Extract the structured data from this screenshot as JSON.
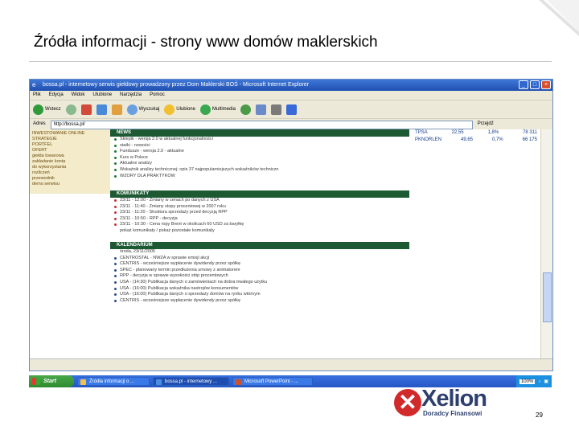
{
  "slide": {
    "title": "Źródła informacji - strony www domów maklerskich",
    "page_number": "29"
  },
  "browser": {
    "window_title": "bossa.pl - internetowy serwis giełdowy prowadzony przez Dom Maklerski BOŚ - Microsoft Internet Explorer",
    "menu": [
      "Plik",
      "Edycja",
      "Widok",
      "Ulubione",
      "Narzędzia",
      "Pomoc"
    ],
    "toolbar": {
      "back_label": "Wstecz",
      "search_label": "Wyszukaj",
      "favorites_label": "Ulubione",
      "multimedia_label": "Multimedia"
    },
    "address_label": "Adres",
    "address_value": "http://bossa.pl/",
    "go_label": "Przejdź"
  },
  "page": {
    "left_nav": [
      "INWESTOWANIE ONLINE",
      "STRATEGIE",
      "PORTFEL",
      "OFERT",
      "giełda towarowa",
      "zakładanie konta",
      "do wykorzystania",
      "rozliczeń",
      "przewodnik",
      "demo serwisu"
    ],
    "sections": [
      {
        "heading": "NEWS",
        "lines": [
          "Sklepik - wersja 2.0 w aktualnej funkcjonalności",
          "statki - nowości",
          "Fundusze - wersja 2.0 - aktualne",
          "Kurs w Polsce",
          "Aktualne analizy",
          "Wskaźnik analizy technicznej: opis 37 najpopularniejszych wskaźników techniczn",
          "WZORY DLA PRAKTYKÓW"
        ]
      },
      {
        "heading": "KOMUNIKATY",
        "lines": [
          "23/11 - 12:00 - Zmiany w cenach po danych z USA",
          "23/11 - 11:40 - Zmiany stopy procentowej w 2007 roku",
          "23/11 - 11:20 - Struktura sprzedaży przed decyzją RPP",
          "23/11 - 10:50 - RPP - decyzja",
          "23/11 - 10:30 - Cena ropy Brent w okolicach 60 USD za baryłkę",
          "pokaż komunikaty / pokaż pozostałe komunikaty"
        ]
      },
      {
        "heading": "KALENDARIUM",
        "lines": [
          "środa, 23/11/2005",
          "CENTROSTAL - NWZA w sprawie emisji akcji",
          "CENTRIS - wcześniejsze wypłacenie dywidendy przez spółkę",
          "SPEC - planowany termin przedłużenia umowy z animatorem",
          "RPP - decyzja w sprawie wysokości stóp procentowych",
          "USA - (14:30) Publikacja danych o zamówieniach na dobra trwałego użytku",
          "USA - (16:00) Publikacja wskaźnika nastrojów konsumentów",
          "USA - (16:00) Publikacja danych o sprzedaży domów na rynku wtórnym",
          "CENTRIS - wcześniejsze wypłacenie dywidendy przez spółkę"
        ]
      }
    ],
    "stock_table": [
      {
        "name": "TPSA",
        "price": "22,55",
        "change": "1,8%",
        "volume": "78 311"
      },
      {
        "name": "PKNORLEN",
        "price": "49,65",
        "change": "0,7%",
        "volume": "66 175"
      }
    ]
  },
  "taskbar": {
    "start_label": "Start",
    "tasks": [
      "Źródła informacji o ...",
      "bossa.pl - internetowy ...",
      "Microsoft PowerPoint - ..."
    ],
    "zoom": "100%"
  },
  "logo": {
    "word": "Xelion",
    "subtitle": "Doradcy Finansowi"
  },
  "colors": {
    "section_header": "#1d5a34",
    "xp_blue": "#2457c4",
    "logo_red": "#d02a2a",
    "logo_navy": "#2e3f6f"
  }
}
